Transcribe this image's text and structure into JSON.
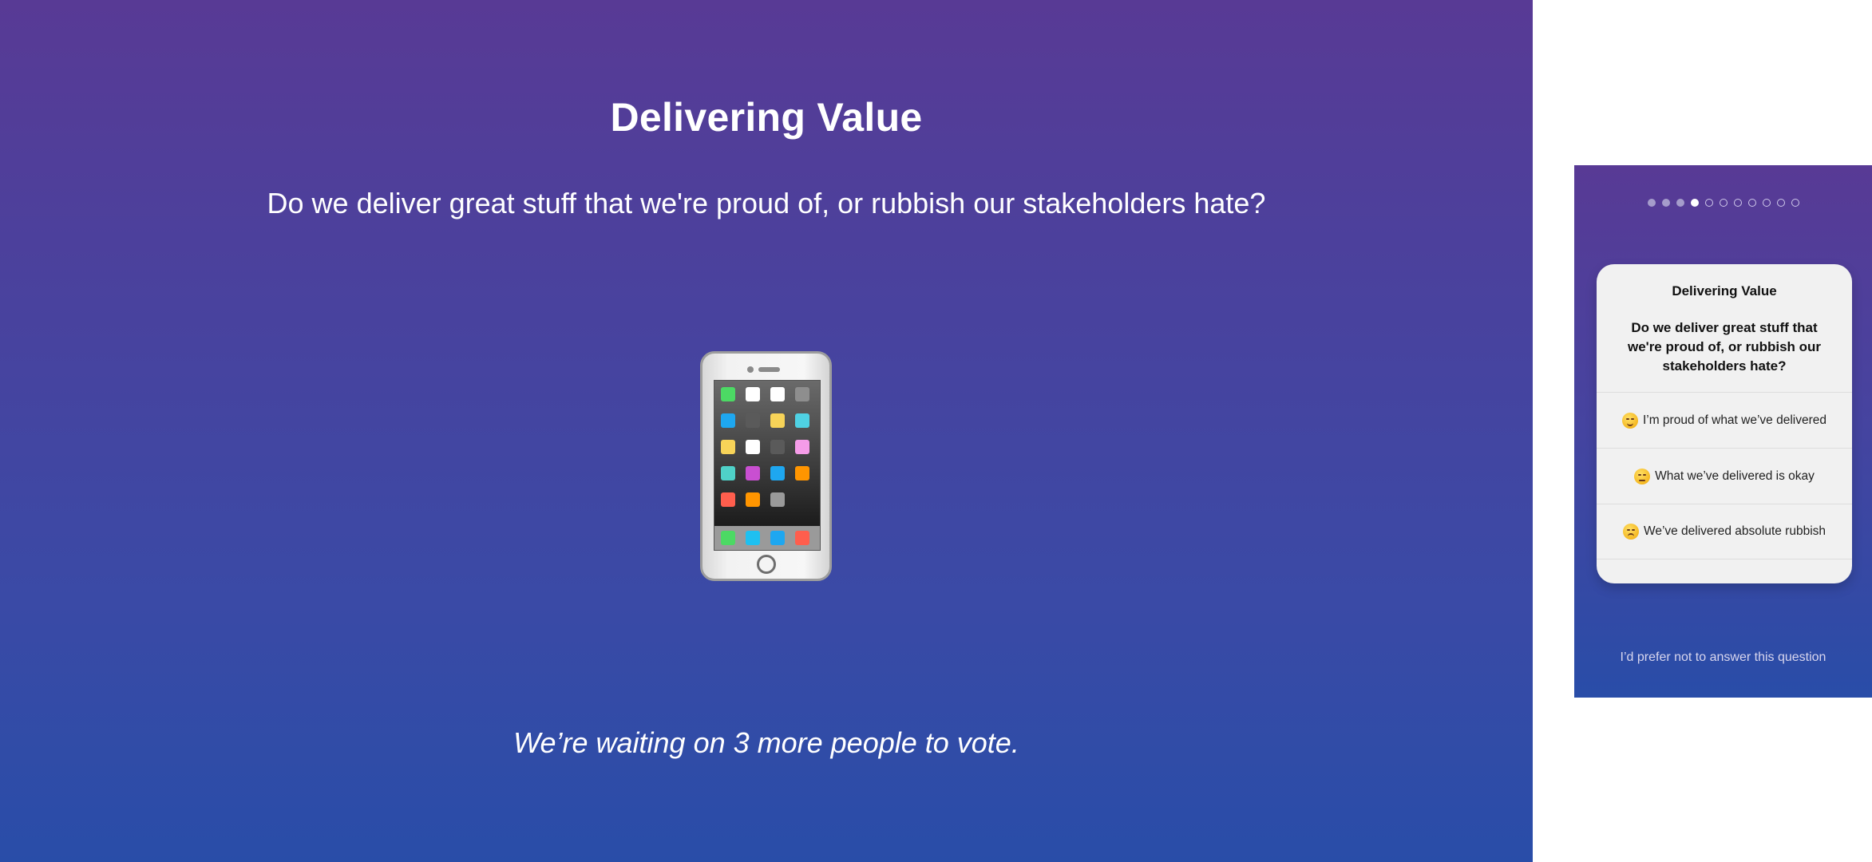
{
  "presenter": {
    "title": "Delivering Value",
    "question": "Do we deliver great stuff that we're proud of, or rubbish our stakeholders hate?",
    "illustration": "mobile-phone-icon",
    "waiting_text": "We’re waiting on 3 more people to vote."
  },
  "mobile": {
    "progress": {
      "total": 11,
      "completed": 3,
      "current": 4
    },
    "card": {
      "title": "Delivering Value",
      "question": "Do we deliver great stuff that we're proud of, or rubbish our stakeholders hate?",
      "options": [
        {
          "label": "I’m proud of what we’ve delivered",
          "icon": "relieved-face-icon"
        },
        {
          "label": "What we’ve delivered is okay",
          "icon": "neutral-face-icon"
        },
        {
          "label": "We’ve delivered absolute rubbish",
          "icon": "unamused-face-icon"
        }
      ]
    },
    "skip_label": "I’d prefer not to answer this question"
  },
  "colors": {
    "gradient_top": "#583a95",
    "gradient_bottom": "#294da8",
    "card_background": "#f1f1f1"
  }
}
